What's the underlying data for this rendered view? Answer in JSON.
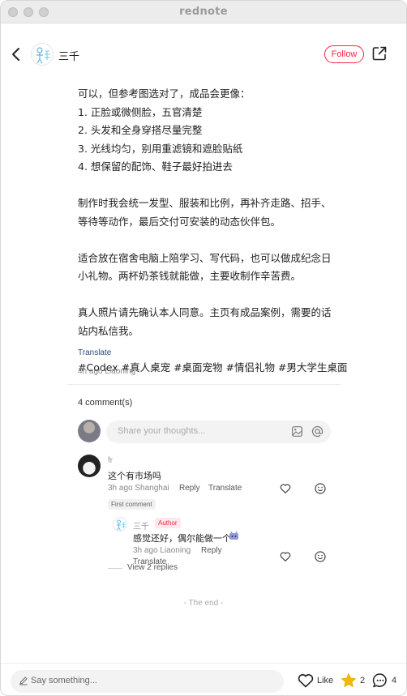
{
  "window": {
    "title": "rednote"
  },
  "header": {
    "author_name": "三千",
    "follow_label": "Follow"
  },
  "post": {
    "lines_block1": [
      "可以，但参考图选对了，成品会更像：",
      "1. 正脸或微侧脸，五官清楚",
      "2. 头发和全身穿搭尽量完整",
      "3. 光线均匀，别用重滤镜和遮脸贴纸",
      "4. 想保留的配饰、鞋子最好拍进去"
    ],
    "lines_block2": [
      "制作时我会统一发型、服装和比例，再补齐走路、招手、",
      "等待等动作，最后交付可安装的动态伙伴包。"
    ],
    "lines_block3": [
      "适合放在宿舍电脑上陪学习、写代码，也可以做成纪念日",
      "小礼物。两杯奶茶钱就能做，主要收制作辛苦费。"
    ],
    "lines_block4": [
      "真人照片请先确认本人同意。主页有成品案例，需要的话",
      "站内私信我。"
    ],
    "hashtags": "#Codex #真人桌宠 #桌面宠物 #情侣礼物 #男大学生桌面",
    "translate_label": "Translate",
    "meta": "4h ago Liaoning"
  },
  "comments": {
    "count_label": "4 comment(s)",
    "input_placeholder": "Share your thoughts...",
    "items": [
      {
        "name": "fr",
        "text": "这个有市场吗",
        "meta": "3h ago Shanghai",
        "reply_label": "Reply",
        "translate_label": "Translate",
        "badge": "First comment"
      }
    ],
    "reply": {
      "name": "三千",
      "badge": "Author",
      "text": "感觉还好，偶尔能做一个",
      "meta": "3h ago Liaoning",
      "reply_label": "Reply",
      "translate_label": "Translate"
    },
    "view_replies": "View 2 replies",
    "end_label": "- The end -"
  },
  "bottom_bar": {
    "say_placeholder": "Say something...",
    "like_label": "Like",
    "star_count": "2",
    "comment_count": "4"
  }
}
